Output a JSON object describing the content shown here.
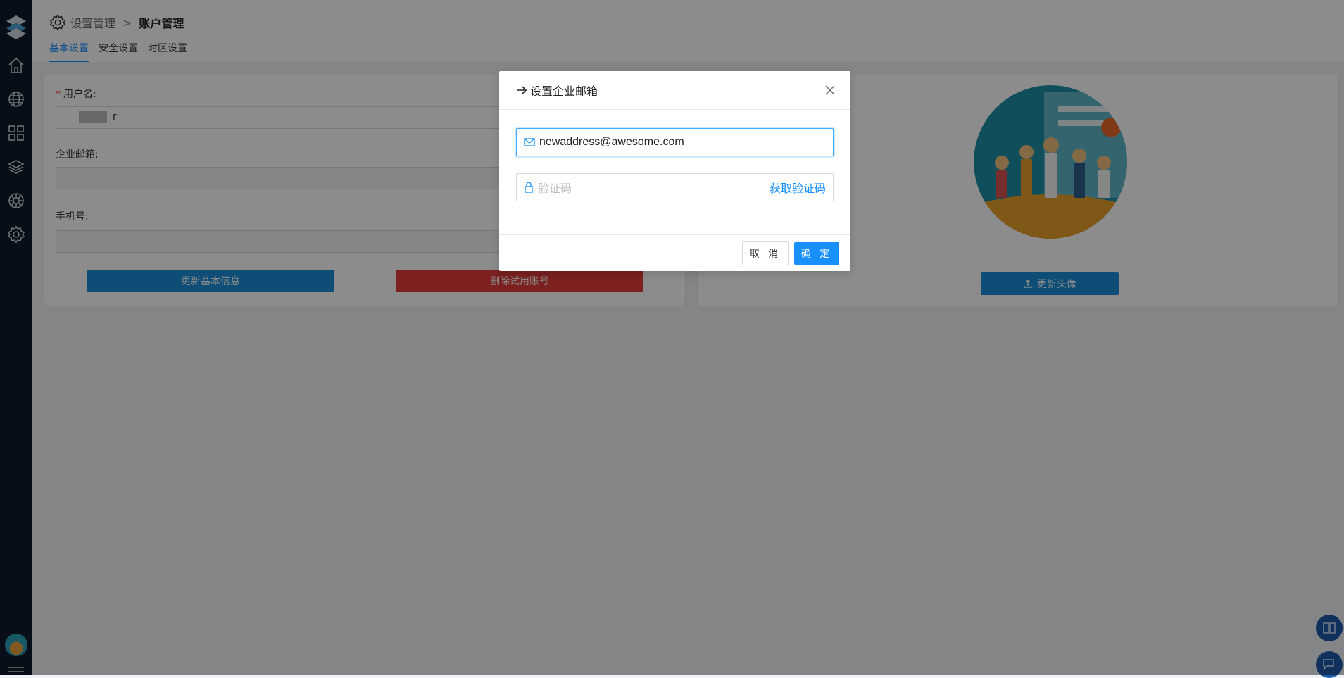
{
  "sidebar": {
    "icons": [
      "home-icon",
      "globe-icon",
      "apps-grid-icon",
      "layers-icon",
      "helm-icon",
      "gear-icon"
    ],
    "menu_icon": "menu-icon"
  },
  "breadcrumb": {
    "parent": "设置管理",
    "separator": ">",
    "current": "账户管理"
  },
  "tabs": [
    {
      "label": "基本设置",
      "active": true
    },
    {
      "label": "安全设置",
      "active": false
    },
    {
      "label": "时区设置",
      "active": false
    }
  ],
  "basic_form": {
    "username_label": "用户名:",
    "username_value": "r",
    "email_label": "企业邮箱:",
    "phone_label": "手机号:",
    "update_button": "更新基本信息",
    "delete_button": "删除试用账号"
  },
  "avatar_card": {
    "upload_button": "更新头像"
  },
  "modal": {
    "title": "设置企业邮箱",
    "email_value": "newaddress@awesome.com",
    "code_placeholder": "验证码",
    "get_code_label": "获取验证码",
    "cancel_label": "取 消",
    "ok_label": "确 定"
  },
  "colors": {
    "sidebar_bg": "#0f1b2d",
    "primary": "#1890ff",
    "danger": "#e23b3b"
  }
}
